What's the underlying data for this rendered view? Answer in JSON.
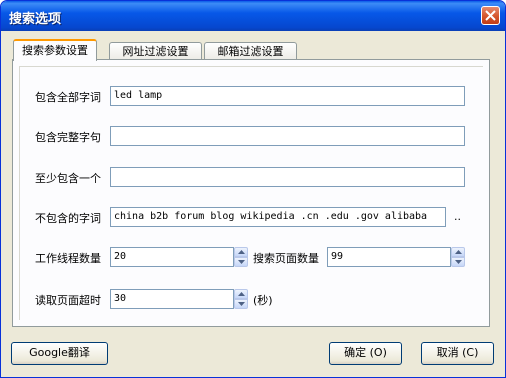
{
  "window": {
    "title": "搜索选项"
  },
  "tabs": [
    {
      "label": "搜索参数设置",
      "active": true
    },
    {
      "label": "网址过滤设置",
      "active": false
    },
    {
      "label": "邮箱过滤设置",
      "active": false
    }
  ],
  "form": {
    "all_words": {
      "label": "包含全部字词",
      "value": "led lamp"
    },
    "exact_phrase": {
      "label": "包含完整字句",
      "value": ""
    },
    "any_word": {
      "label": "至少包含一个",
      "value": ""
    },
    "exclude_words": {
      "label": "不包含的字词",
      "value": "china b2b forum blog wikipedia .cn .edu .gov alibaba",
      "more": ".."
    },
    "thread_count": {
      "label": "工作线程数量",
      "value": "20"
    },
    "search_pages": {
      "label": "搜索页面数量",
      "value": "99"
    },
    "read_timeout": {
      "label": "读取页面超时",
      "value": "30",
      "unit": "(秒)"
    }
  },
  "buttons": {
    "google_translate": "Google翻译",
    "ok": "确定 (O)",
    "cancel": "取消 (C)"
  },
  "colors": {
    "titlebar": "#0758e8",
    "accent_tab": "#ff9900",
    "dialog_bg": "#ece9d8"
  }
}
